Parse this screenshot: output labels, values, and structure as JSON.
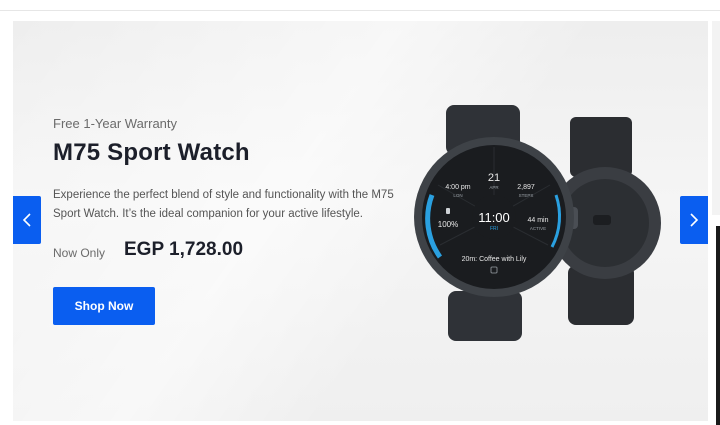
{
  "hero": {
    "eyebrow": "Free 1-Year Warranty",
    "title": "M75 Sport Watch",
    "description": "Experience the perfect blend of style and functionality with the M75 Sport Watch. It’s the ideal companion for your active lifestyle.",
    "price_label": "Now Only",
    "price": "EGP 1,728.00",
    "cta_label": "Shop Now"
  },
  "watch_face": {
    "date_day": "21",
    "date_month": "APR",
    "time_left": "4:00 pm",
    "time_left_sub": "LON",
    "steps": "2,897",
    "steps_label": "STEPS",
    "battery": "100%",
    "time": "11:00",
    "weekday": "FRI",
    "active": "44 min",
    "active_label": "ACTIVE",
    "event": "20m: Coffee with Lily"
  },
  "nav": {
    "prev_icon": "chevron-left-icon",
    "next_icon": "chevron-right-icon"
  },
  "colors": {
    "accent": "#0a5ef0",
    "title": "#1c1f2a",
    "watch_accent": "#2aa0e0"
  }
}
